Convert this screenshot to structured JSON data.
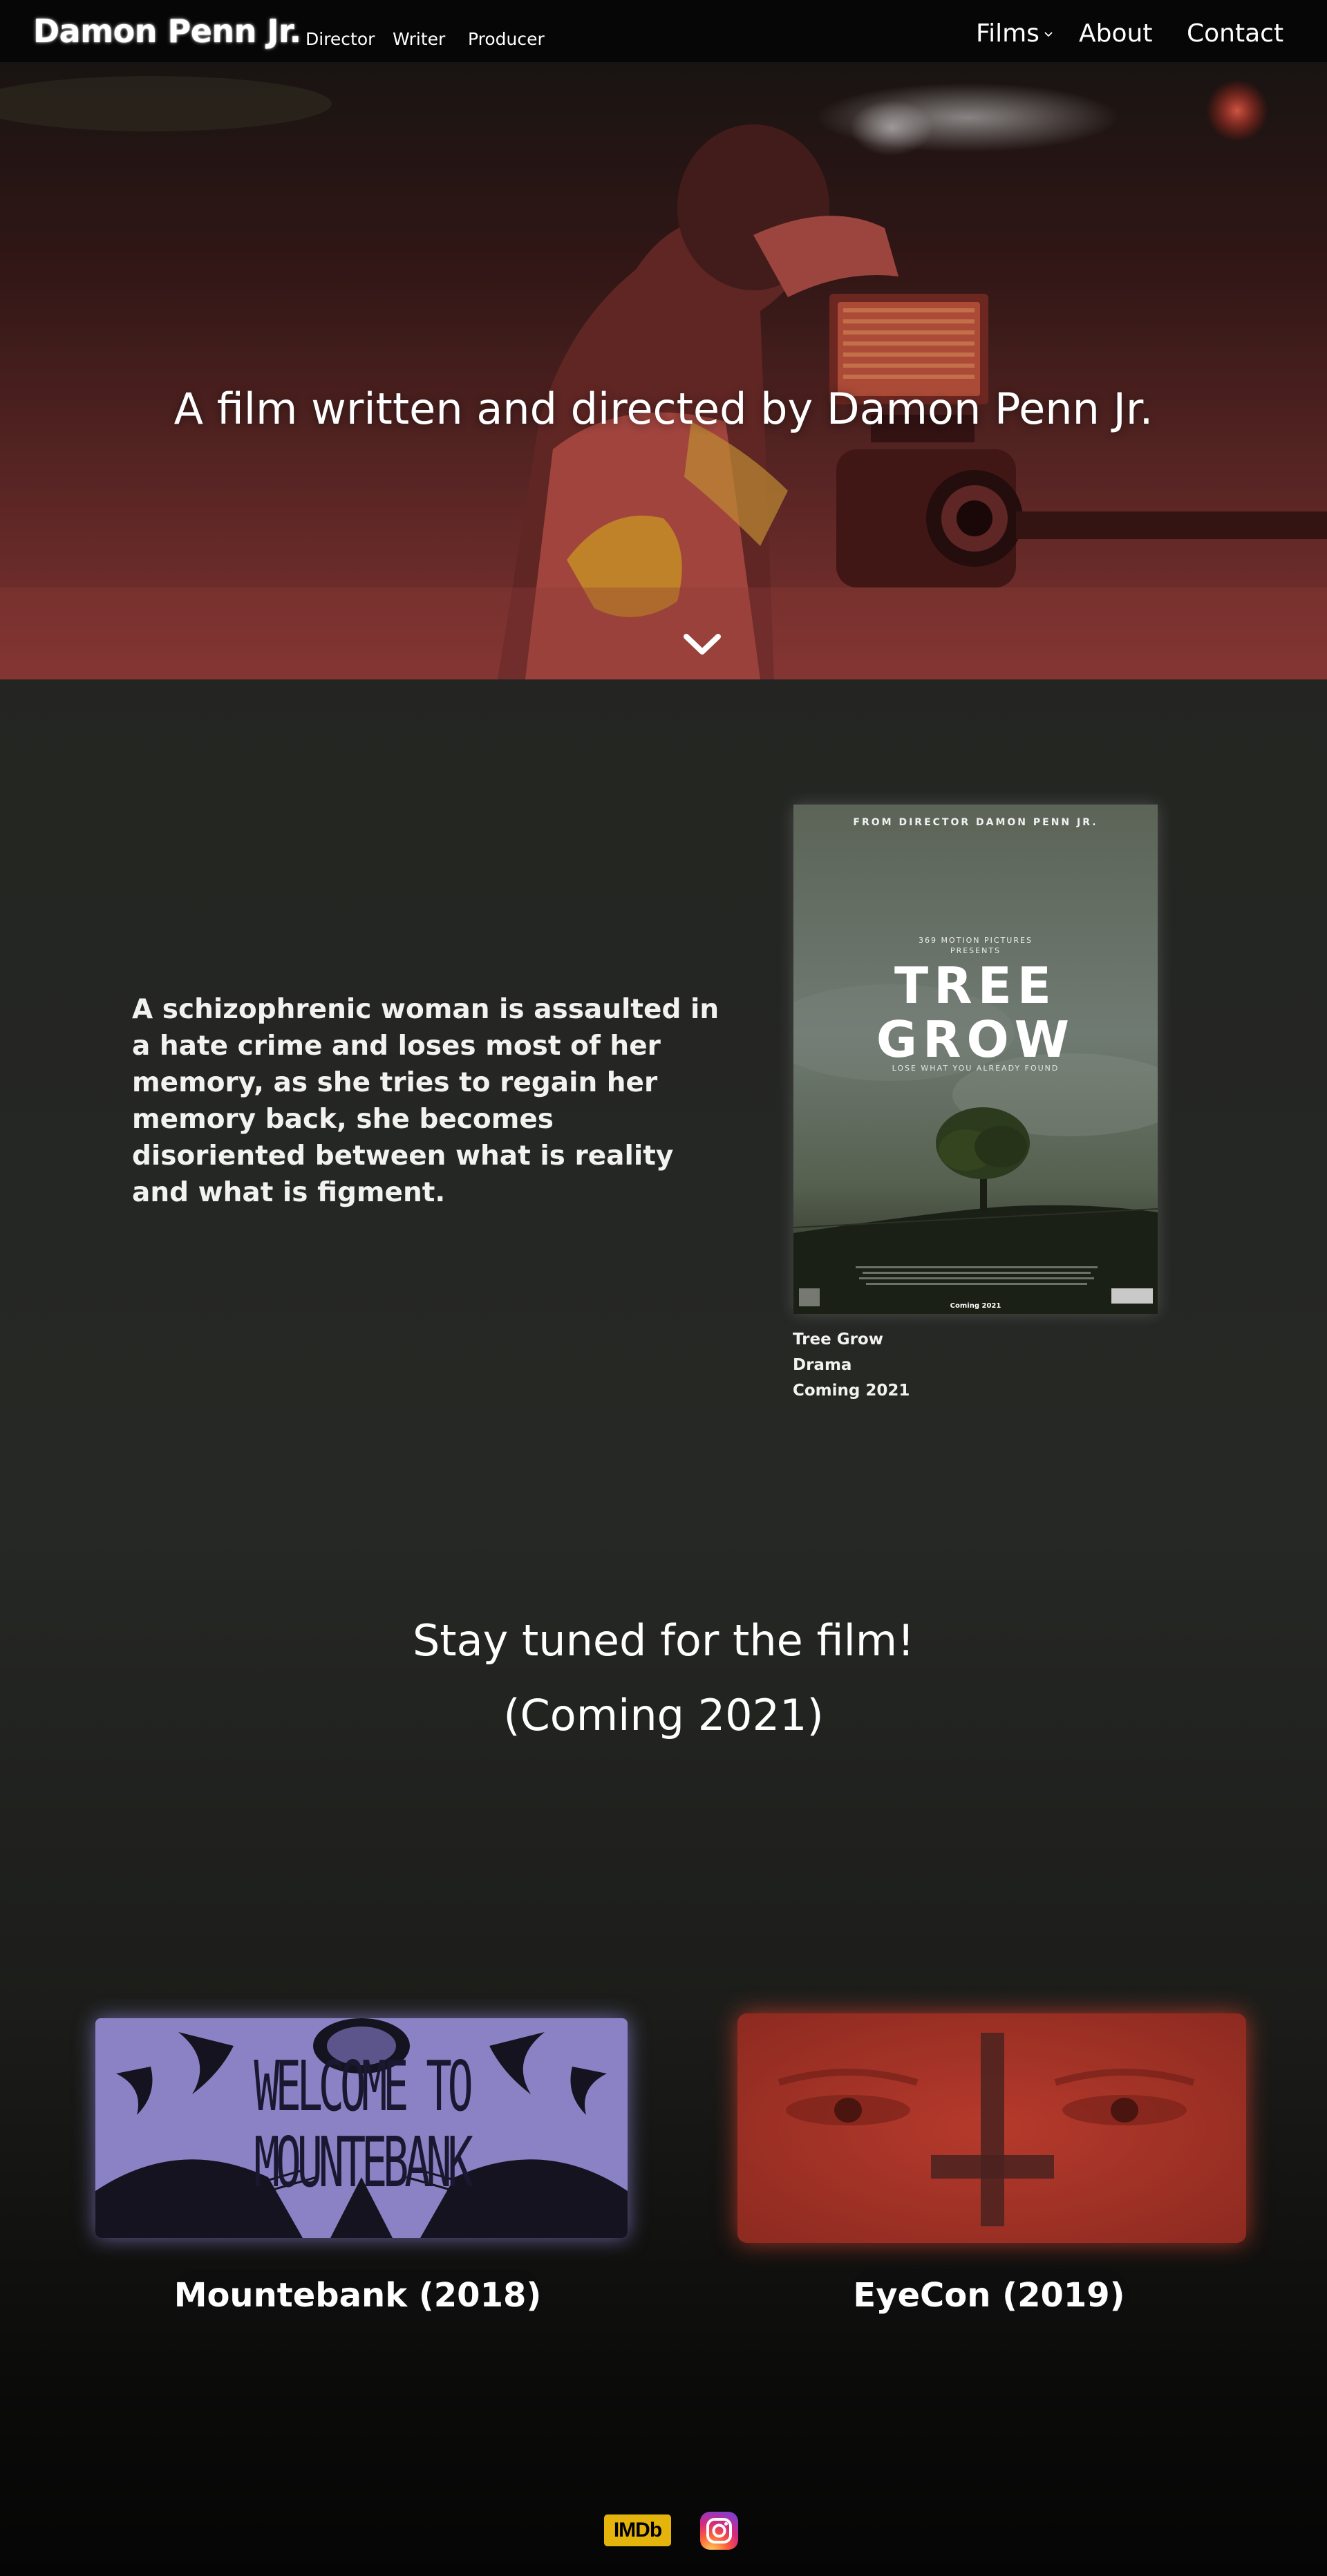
{
  "nav": {
    "brand": "Damon Penn Jr.",
    "roles": [
      "Director",
      "Writer",
      "Producer"
    ],
    "films_label": "Films",
    "about_label": "About",
    "contact_label": "Contact"
  },
  "hero": {
    "title": "A film written and directed by Damon Penn Jr.",
    "scroll_icon": "chevron-down-icon"
  },
  "feature": {
    "synopsis": "A schizophrenic woman is assaulted in a hate crime and loses most of her memory, as she tries to regain her memory back, she becomes disoriented between what is reality and what is figment.",
    "poster": {
      "top_line": "FROM DIRECTOR DAMON PENN JR.",
      "studio": "369 MOTION PICTURES",
      "presents": "PRESENTS",
      "title_line1": "TREE",
      "title_line2": "GROW",
      "tagline": "LOSE WHAT YOU ALREADY FOUND",
      "coming": "Coming 2021"
    },
    "title": "Tree Grow",
    "genre": "Drama",
    "release": "Coming 2021"
  },
  "stay_tuned": {
    "line1": "Stay tuned for the film!",
    "line2": "(Coming 2021)"
  },
  "films": [
    {
      "card_text_line1": "WELCOME TO",
      "card_text_line2": "MOUNTEBANK",
      "label": "Mountebank  (2018)",
      "accent": "#8b82c6"
    },
    {
      "label": "EyeCon (2019)",
      "accent": "#a83025"
    }
  ],
  "footer": {
    "imdb_label": "IMDb",
    "imdb_color": "#e5b40c",
    "instagram_icon": "instagram-icon"
  }
}
